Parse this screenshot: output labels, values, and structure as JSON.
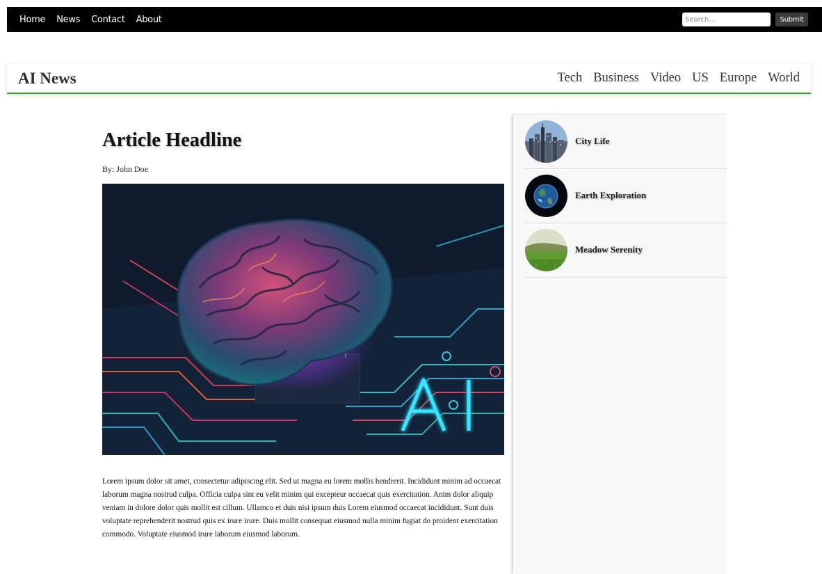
{
  "topbar": {
    "nav": [
      "Home",
      "News",
      "Contact",
      "About"
    ],
    "search_placeholder": "Search...",
    "submit_label": "Submit"
  },
  "header": {
    "logo": "AI News",
    "categories": [
      "Tech",
      "Business",
      "Video",
      "US",
      "Europe",
      "World"
    ]
  },
  "article": {
    "headline": "Article Headline",
    "byline": "By: John Doe",
    "image_overlay_text": "AI",
    "body": "Lorem ipsum dolor sit amet, consectetur adipiscing elit. Sed ut magna eu lorem mollis hendrerit. Incididunt minim ad occaecat laborum magna nostrud culpa. Officia culpa sint eu velit minim qui excepteur occaecat quis exercitation. Anim dolor aliquip veniam in dolore dolor quis mollit est cillum. Ullamco et duis nisi ipsum duis Lorem eiusmod occaecat incididunt. Sunt duis voluptate reprehenderit nostrud quis ex irure irure. Duis mollit consequat eiusmod nulla minim fugiat do proident exercitation commodo. Voluptate eiusmod irure laborum eiusmod laborum."
  },
  "sidebar": {
    "items": [
      {
        "title": "City Life"
      },
      {
        "title": "Earth Exploration"
      },
      {
        "title": "Meadow Serenity"
      }
    ]
  },
  "colors": {
    "topbar_bg": "#000000",
    "header_accent": "#3aa335",
    "sidebar_bg": "#f8f8f8"
  }
}
